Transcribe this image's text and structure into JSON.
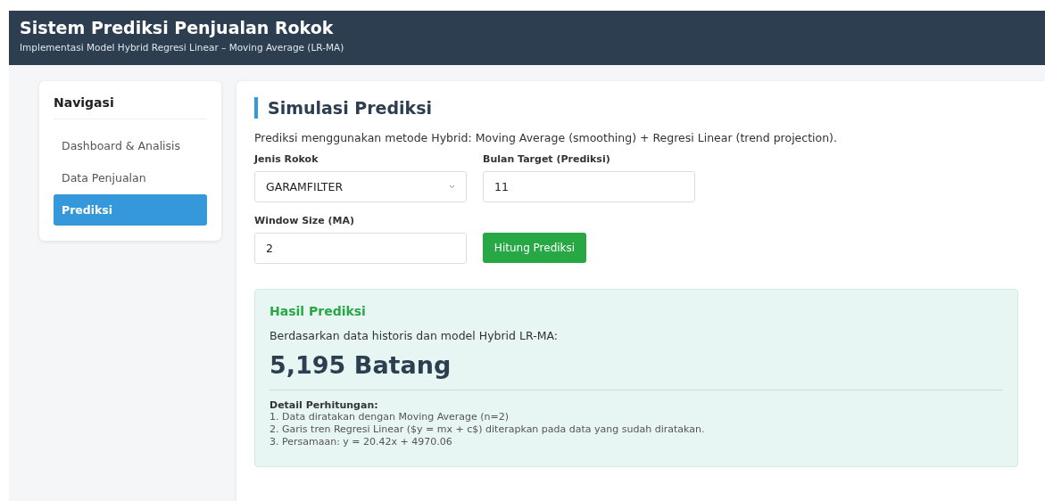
{
  "header": {
    "title": "Sistem Prediksi Penjualan Rokok",
    "subtitle": "Implementasi Model Hybrid Regresi Linear – Moving Average (LR-MA)"
  },
  "sidebar": {
    "title": "Navigasi",
    "items": [
      {
        "label": "Dashboard & Analisis",
        "selected": false
      },
      {
        "label": "Data Penjualan",
        "selected": false
      },
      {
        "label": "Prediksi",
        "selected": true
      }
    ]
  },
  "main": {
    "title": "Simulasi Prediksi",
    "description": "Prediksi menggunakan metode Hybrid: Moving Average (smoothing) + Regresi Linear (trend projection).",
    "fields": [
      {
        "kind": "select",
        "label": "Jenis Rokok",
        "value": "GARAMFILTER"
      },
      {
        "kind": "input",
        "label": "Bulan Target (Prediksi)",
        "value": "11"
      },
      {
        "kind": "input",
        "label": "Window Size (MA)",
        "value": "2"
      }
    ],
    "button": "Hitung Prediksi",
    "result": {
      "title": "Hasil Prediksi",
      "intro": "Berdasarkan data historis dan model Hybrid LR-MA:",
      "value": "5,195 Batang",
      "detail_title": "Detail Perhitungan:",
      "details": [
        "1. Data diratakan dengan Moving Average (n=2)",
        "2. Garis tren Regresi Linear ($y = mx + c$) diterapkan pada data yang sudah diratakan.",
        "3. Persamaan: y = 20.42x + 4970.06"
      ]
    }
  }
}
